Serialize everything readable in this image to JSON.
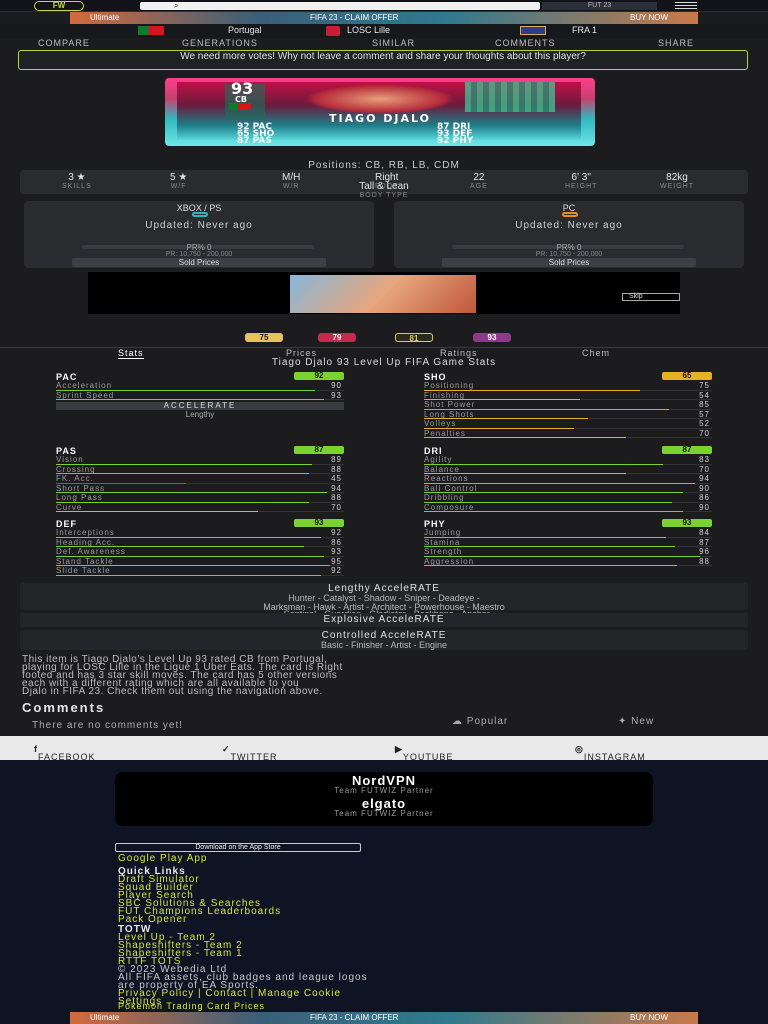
{
  "header": {
    "logo_text": "FW",
    "version_label": "FUT 23",
    "banner_left": "Ultimate",
    "banner_mid": "FIFA 23 - CLAIM OFFER",
    "banner_right": "BUY NOW"
  },
  "club": {
    "nation": "Portugal",
    "club": "LOSC Lille",
    "league": "FRA 1"
  },
  "nav": [
    "COMPARE",
    "GENERATIONS",
    "SIMILAR",
    "COMMENTS",
    "SHARE"
  ],
  "vote_notice": "We need more votes! Why not leave a comment and share your thoughts about this player?",
  "card": {
    "rating": "93",
    "position": "CB",
    "name": "TIAGO DJALO",
    "stats_left": [
      "92 PAC",
      "65 SHO",
      "87 PAS"
    ],
    "stats_right": [
      "87 DRI",
      "93 DEF",
      "92 PHY"
    ]
  },
  "positions_line": "Positions: CB, RB, LB, CDM",
  "attrs": [
    {
      "value": "3 ★",
      "label": "SKILLS"
    },
    {
      "value": "5 ★",
      "label": "W/F"
    },
    {
      "value": "M/H",
      "label": "W/R"
    },
    {
      "value": "Right",
      "label": "FOOT"
    },
    {
      "value": "22",
      "label": "AGE"
    },
    {
      "value": "6' 3\"",
      "label": "HEIGHT"
    },
    {
      "value": "82kg",
      "label": "WEIGHT"
    }
  ],
  "body_type": "Tall & Lean",
  "body_type_label": "BODY TYPE",
  "prices": [
    {
      "platform": "XBOX / PS",
      "updated": "Updated: Never ago",
      "pr": "PR% 0",
      "range": "PR: 10,750 - 200,000",
      "sold": "Sold Prices",
      "ring_color": "#2fb7c0"
    },
    {
      "platform": "PC",
      "updated": "Updated: Never ago",
      "pr": "PR% 0",
      "range": "PR: 10,750 - 200,000",
      "sold": "Sold Prices",
      "ring_color": "#f08a1c"
    }
  ],
  "ad": {
    "skip": "Skip"
  },
  "versions": [
    {
      "label": "75",
      "bg": "#e6c35a"
    },
    {
      "label": "79",
      "bg": "#c8284a"
    },
    {
      "label": "81",
      "bg": "#2c2a1a"
    },
    {
      "label": "93",
      "bg": "#8e3a8a"
    }
  ],
  "tabs": [
    "Stats",
    "Prices",
    "Ratings",
    "Chem"
  ],
  "stat_title": "Tiago Djalo 93 Level Up FIFA Game Stats",
  "stats": {
    "pac": {
      "name": "PAC",
      "value": "92",
      "color": "#7bd12d",
      "rows": [
        {
          "label": "Acceleration",
          "value": "90",
          "pct": 90,
          "color": "#7bd12d"
        },
        {
          "label": "Sprint Speed",
          "value": "93",
          "pct": 93,
          "color": "#7bd12d"
        }
      ],
      "accel": "ACCELERATE",
      "accel_type": "Lengthy"
    },
    "sho": {
      "name": "SHO",
      "value": "65",
      "color": "#e6b223",
      "rows": [
        {
          "label": "Positioning",
          "value": "75",
          "pct": 75,
          "color": "#e6b223"
        },
        {
          "label": "Finishing",
          "value": "54",
          "pct": 54,
          "color": "#e6b223"
        },
        {
          "label": "Shot Power",
          "value": "85",
          "pct": 85,
          "color": "#7bd12d"
        },
        {
          "label": "Long Shots",
          "value": "57",
          "pct": 57,
          "color": "#e6b223"
        },
        {
          "label": "Volleys",
          "value": "52",
          "pct": 52,
          "color": "#e6b223"
        },
        {
          "label": "Penalties",
          "value": "70",
          "pct": 70,
          "color": "#e6b223"
        }
      ]
    },
    "pas": {
      "name": "PAS",
      "value": "87",
      "color": "#7bd12d",
      "rows": [
        {
          "label": "Vision",
          "value": "89",
          "pct": 89,
          "color": "#7bd12d"
        },
        {
          "label": "Crossing",
          "value": "88",
          "pct": 88,
          "color": "#7bd12d"
        },
        {
          "label": "FK. Acc.",
          "value": "45",
          "pct": 45,
          "color": "#d93a2a"
        },
        {
          "label": "Short Pass",
          "value": "94",
          "pct": 94,
          "color": "#7bd12d"
        },
        {
          "label": "Long Pass",
          "value": "88",
          "pct": 88,
          "color": "#7bd12d"
        },
        {
          "label": "Curve",
          "value": "70",
          "pct": 70,
          "color": "#e6b223"
        }
      ]
    },
    "dri": {
      "name": "DRI",
      "value": "87",
      "color": "#7bd12d",
      "rows": [
        {
          "label": "Agility",
          "value": "83",
          "pct": 83,
          "color": "#7bd12d"
        },
        {
          "label": "Balance",
          "value": "70",
          "pct": 70,
          "color": "#e6b223"
        },
        {
          "label": "Reactions",
          "value": "94",
          "pct": 94,
          "color": "#7bd12d"
        },
        {
          "label": "Ball Control",
          "value": "90",
          "pct": 90,
          "color": "#7bd12d"
        },
        {
          "label": "Dribbling",
          "value": "86",
          "pct": 86,
          "color": "#7bd12d"
        },
        {
          "label": "Composure",
          "value": "90",
          "pct": 90,
          "color": "#7bd12d"
        }
      ]
    },
    "def": {
      "name": "DEF",
      "value": "93",
      "color": "#7bd12d",
      "rows": [
        {
          "label": "Interceptions",
          "value": "92",
          "pct": 92,
          "color": "#7bd12d"
        },
        {
          "label": "Heading Acc.",
          "value": "86",
          "pct": 86,
          "color": "#7bd12d"
        },
        {
          "label": "Def. Awareness",
          "value": "93",
          "pct": 93,
          "color": "#7bd12d"
        },
        {
          "label": "Stand Tackle",
          "value": "95",
          "pct": 95,
          "color": "#7bd12d"
        },
        {
          "label": "Slide Tackle",
          "value": "92",
          "pct": 92,
          "color": "#7bd12d"
        }
      ]
    },
    "phy": {
      "name": "PHY",
      "value": "93",
      "color": "#7bd12d",
      "rows": [
        {
          "label": "Jumping",
          "value": "84",
          "pct": 84,
          "color": "#7bd12d"
        },
        {
          "label": "Stamina",
          "value": "87",
          "pct": 87,
          "color": "#7bd12d"
        },
        {
          "label": "Strength",
          "value": "96",
          "pct": 96,
          "color": "#7bd12d"
        },
        {
          "label": "Aggression",
          "value": "88",
          "pct": 88,
          "color": "#7bd12d"
        }
      ]
    }
  },
  "accelerate": {
    "lengthy_title": "Lengthy AcceleRATE",
    "lengthy_line1": "Hunter - Catalyst - Shadow - Sniper - Deadeye -",
    "lengthy_line2": "Marksman - Hawk - Artist - Architect - Powerhouse - Maestro",
    "lengthy_line3": "- Sentinel - Guardian - Gladiator - Backbone - Anchor",
    "explosive_title": "Explosive AcceleRATE",
    "controlled_title": "Controlled AcceleRATE",
    "controlled_line": "Basic - Finisher - Artist - Engine"
  },
  "description": {
    "line1": "This item is Tiago Djalo's Level Up 93 rated CB from Portugal,",
    "line2": "playing for LOSC Lille in the Ligue 1 Uber Eats. The card is Right",
    "line3": "footed and has 3 star skill moves. The card has 5 other versions",
    "line4": "each with a different rating which are all available to you",
    "line5": "Djalo in FIFA 23. Check them out using the navigation above."
  },
  "comments": {
    "title": "Comments",
    "empty": "There are no comments yet!",
    "sort_popular": "Popular",
    "sort_new": "New"
  },
  "social": [
    "FACEBOOK",
    "TWITTER",
    "YOUTUBE",
    "INSTAGRAM"
  ],
  "partners": [
    {
      "name": "NordVPN",
      "sub": "Team FUTWIZ Partner"
    },
    {
      "name": "elgato",
      "sub": "Team FUTWIZ Partner"
    }
  ],
  "footer": {
    "appstore": "Download on the App Store",
    "googleplay": "Google Play App",
    "quicklinks_title": "Quick Links",
    "quicklinks": [
      "Draft Simulator",
      "Squad Builder",
      "Player Search",
      "SBC Solutions & Searches",
      "FUT Champions Leaderboards",
      "Pack Opener"
    ],
    "totw_title": "TOTW",
    "totw": [
      "Level Up - Team 2",
      "Shapeshifters - Team 2",
      "Shapeshifters - Team 1",
      "RTTF TOTS"
    ],
    "copyright": "© 2023 Webedia Ltd",
    "legal1": "All FIFA assets, club badges and league logos",
    "legal2": "are property of EA Sports.",
    "privacy": "Privacy Policy | Contact | Manage Cookie",
    "settings": "Settings",
    "pokemon": "Pokemon Trading Card Prices"
  }
}
